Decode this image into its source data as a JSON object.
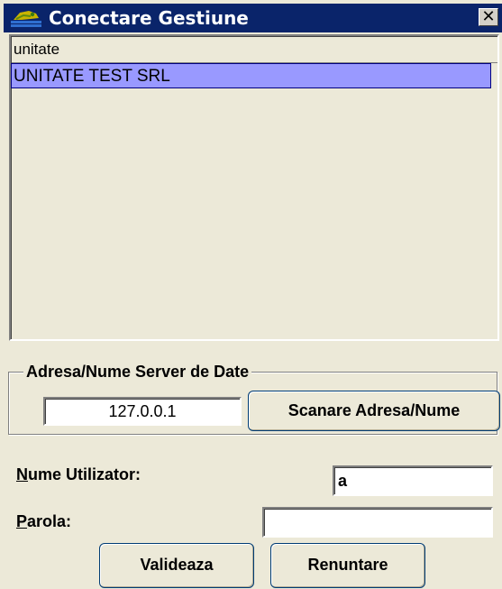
{
  "window": {
    "title": "Conectare Gestiune",
    "close_glyph": "✕",
    "title_icon": "app-icon"
  },
  "list": {
    "header": "unitate",
    "items": [
      {
        "label": "UNITATE TEST SRL",
        "selected": true
      }
    ]
  },
  "server_group": {
    "legend": "Adresa/Nume  Server de Date",
    "address_value": "127.0.0.1",
    "scan_button": "Scanare Adresa/Nume"
  },
  "login": {
    "user_label_first": "N",
    "user_label_rest": "ume Utilizator:",
    "user_value": "a",
    "password_label_first": "P",
    "password_label_rest": "arola:",
    "password_value": ""
  },
  "buttons": {
    "validate": "Valideaza",
    "cancel": "Renuntare"
  },
  "colors": {
    "titlebar": "#0a246a",
    "selection": "#9999ff",
    "face": "#ece9d8"
  }
}
